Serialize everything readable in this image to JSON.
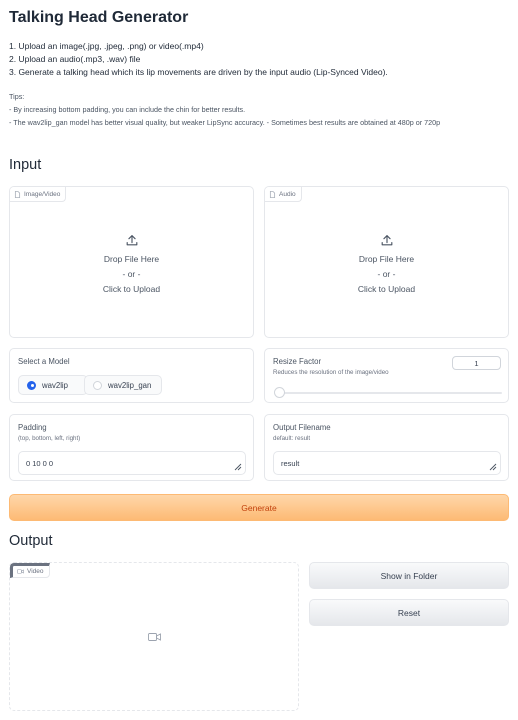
{
  "app": {
    "title": "Talking Head Generator",
    "steps": [
      "1. Upload an image(.jpg, .jpeg, .png) or video(.mp4)",
      "2. Upload an audio(.mp3, .wav) file",
      "3. Generate a talking head which its lip movements are driven by the input audio (Lip-Synced Video)."
    ],
    "tips_title": "Tips:",
    "tips": [
      "- By increasing bottom padding, you can include the chin for better results.",
      "- The wav2lip_gan model has better visual quality, but weaker LipSync accuracy. - Sometimes best results are obtained at 480p or 720p"
    ]
  },
  "input": {
    "section_title": "Input",
    "image_video": {
      "tag": "Image/Video",
      "drop_text": "Drop File Here",
      "or_text": "- or -",
      "click_text": "Click to Upload"
    },
    "audio": {
      "tag": "Audio",
      "drop_text": "Drop File Here",
      "or_text": "- or -",
      "click_text": "Click to Upload"
    },
    "model": {
      "label": "Select a Model",
      "options": [
        "wav2lip",
        "wav2lip_gan"
      ],
      "selected": "wav2lip"
    },
    "resize": {
      "label": "Resize Factor",
      "info": "Reduces the resolution of the image/video",
      "value": "1"
    },
    "padding": {
      "label": "Padding",
      "info": "(top, bottom, left, right)",
      "value": "0 10 0 0"
    },
    "output_filename": {
      "label": "Output Filename",
      "info": "default: result",
      "value": "result"
    },
    "generate_label": "Generate"
  },
  "output": {
    "section_title": "Output",
    "video_tag": "Video",
    "show_folder_label": "Show in Folder",
    "reset_label": "Reset"
  },
  "colors": {
    "accent": "#2563eb",
    "generate_bg": "#fdba74",
    "generate_text": "#c2410c"
  }
}
